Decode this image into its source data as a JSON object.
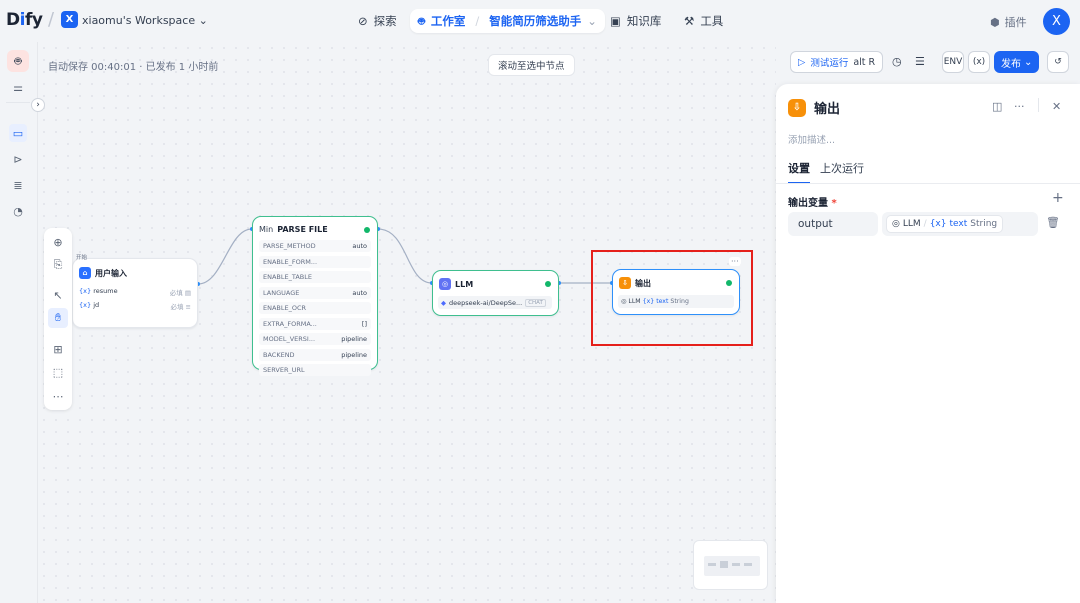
{
  "header": {
    "logo": "Dify",
    "workspace_initial": "X",
    "workspace_name": "xiaomu's Workspace",
    "nav": {
      "explore": "探索",
      "studio": "工作室",
      "app_name": "智能简历筛选助手",
      "knowledge": "知识库",
      "tools": "工具"
    },
    "plugins": "插件",
    "user_initial": "X"
  },
  "canvas": {
    "autosave": "自动保存 00:40:01 · 已发布 1 小时前",
    "scroll_to_selected": "滚动至选中节点"
  },
  "nodes": {
    "start": {
      "tag": "开始",
      "title": "用户输入",
      "vars": [
        {
          "name": "resume",
          "req": "必填"
        },
        {
          "name": "jd",
          "req": "必填"
        }
      ]
    },
    "parse": {
      "prefix": "Min",
      "title": "PARSE FILE",
      "fields": [
        {
          "k": "PARSE_METHOD",
          "v": "auto"
        },
        {
          "k": "ENABLE_FORM...",
          "v": ""
        },
        {
          "k": "ENABLE_TABLE",
          "v": ""
        },
        {
          "k": "LANGUAGE",
          "v": "auto"
        },
        {
          "k": "ENABLE_OCR",
          "v": ""
        },
        {
          "k": "EXTRA_FORMA...",
          "v": "[]"
        },
        {
          "k": "MODEL_VERSI...",
          "v": "pipeline"
        },
        {
          "k": "BACKEND",
          "v": "pipeline"
        },
        {
          "k": "SERVER_URL",
          "v": ""
        }
      ]
    },
    "llm": {
      "title": "LLM",
      "model": "deepseek-ai/DeepSe...",
      "mode": "CHAT"
    },
    "output": {
      "title": "输出",
      "src": "LLM",
      "var": "text",
      "type": "String"
    }
  },
  "run_bar": {
    "test_run": "测试运行",
    "shortcut": "alt R",
    "publish": "发布"
  },
  "panel": {
    "title": "输出",
    "add_desc": "添加描述...",
    "tabs": [
      "设置",
      "上次运行"
    ],
    "section": "输出变量",
    "required_mark": "*",
    "var_name": "output",
    "var_src": "LLM",
    "var_ref": "text",
    "var_type": "String"
  },
  "colors": {
    "accent": "#1c64f2",
    "output_icon": "#f79009",
    "llm_icon": "#6172f3",
    "ok": "#12b76a",
    "highlight": "#e5201b"
  }
}
